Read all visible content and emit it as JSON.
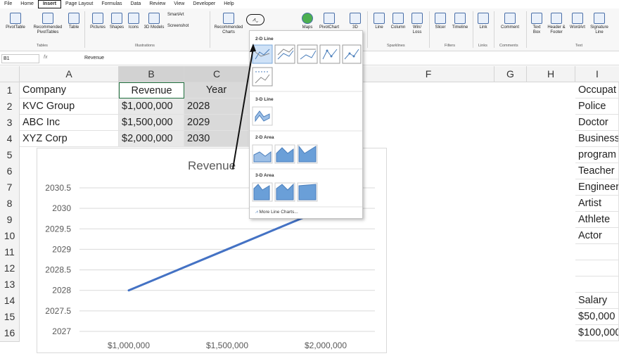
{
  "menu": [
    "File",
    "Home",
    "Insert",
    "Page Layout",
    "Formulas",
    "Data",
    "Review",
    "View",
    "Developer",
    "Help"
  ],
  "ribbon": {
    "buttons": [
      {
        "label": "PivotTable"
      },
      {
        "label": "Recommended PivotTables"
      },
      {
        "label": "Table"
      },
      {
        "label": "Pictures"
      },
      {
        "label": "Shapes"
      },
      {
        "label": "Icons"
      },
      {
        "label": "3D Models"
      },
      {
        "label": "SmartArt"
      },
      {
        "label": "Screenshot"
      },
      {
        "label": "Recommended Charts"
      },
      {
        "label": "Maps"
      },
      {
        "label": "PivotChart"
      },
      {
        "label": "3D"
      },
      {
        "label": "Line"
      },
      {
        "label": "Column"
      },
      {
        "label": "Win/ Loss"
      },
      {
        "label": "Slicer"
      },
      {
        "label": "Timeline"
      },
      {
        "label": "Link"
      },
      {
        "label": "Comment"
      },
      {
        "label": "Text Box"
      },
      {
        "label": "Header & Footer"
      },
      {
        "label": "WordArt"
      },
      {
        "label": "Signature Line"
      }
    ],
    "groups": [
      "Tables",
      "Illustrations",
      "Sparklines",
      "Filters",
      "Links",
      "Comments",
      "Text"
    ]
  },
  "formula_bar": {
    "name_box": "B1",
    "fx": "fx",
    "value": "Revenue"
  },
  "columns": [
    "A",
    "B",
    "C",
    "F",
    "G",
    "H",
    "I"
  ],
  "rows": [
    "1",
    "2",
    "3",
    "4",
    "5",
    "6",
    "7",
    "8",
    "9",
    "10",
    "11",
    "12",
    "13",
    "14",
    "15",
    "16"
  ],
  "table": {
    "header": [
      "Company",
      "Revenue",
      "Year"
    ],
    "rows": [
      [
        "KVC Group",
        "$1,000,000",
        "2028"
      ],
      [
        "ABC Inc",
        "$1,500,000",
        "2029"
      ],
      [
        "XYZ Corp",
        "$2,000,000",
        "2030"
      ]
    ]
  },
  "col_i": [
    "Occupat",
    "Police",
    "Doctor",
    "Business",
    "program",
    "Teacher",
    "Engineer",
    "Artist",
    "Athlete",
    "Actor",
    "",
    "",
    "",
    "Salary",
    "$50,000",
    "$100,000"
  ],
  "dropdown": {
    "sections": [
      "2-D Line",
      "3-D Line",
      "2-D Area",
      "3-D Area"
    ],
    "more": "More Line Charts..."
  },
  "chart_data": {
    "type": "line",
    "title": "Revenue",
    "categories": [
      "$1,000,000",
      "$1,500,000",
      "$2,000,000"
    ],
    "values": [
      2028,
      2029,
      2030
    ],
    "ylim": [
      2027,
      2030.5
    ],
    "yticks": [
      "2027",
      "2027.5",
      "2028",
      "2028.5",
      "2029",
      "2029.5",
      "2030",
      "2030.5"
    ],
    "grid": true,
    "color": "#4472c4"
  }
}
